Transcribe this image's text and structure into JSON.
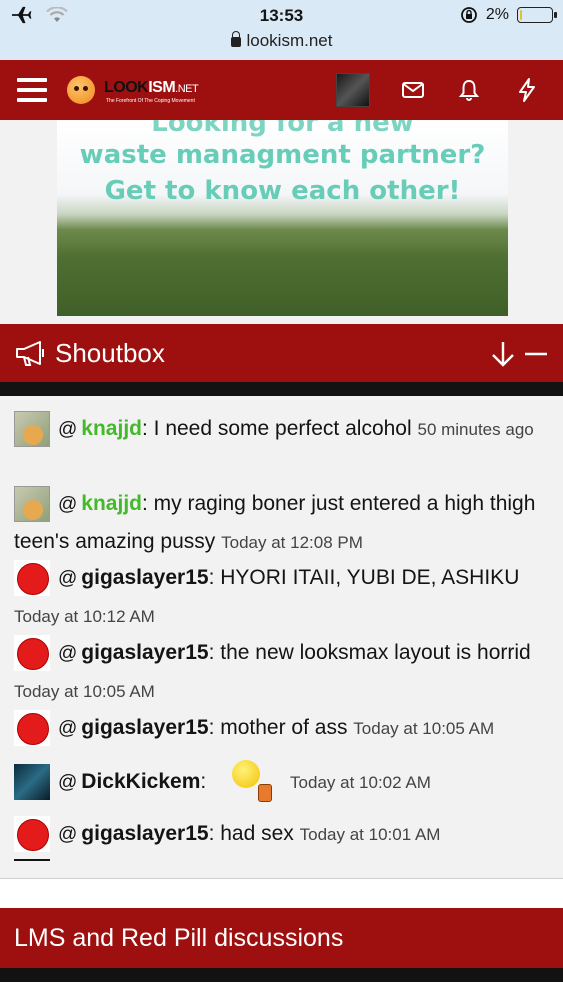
{
  "status_bar": {
    "time": "13:53",
    "battery": "2%",
    "battery_level": 0.02,
    "url": "lookism.net"
  },
  "site": {
    "logo_look": "LOOK",
    "logo_ism": "ISM",
    "logo_net": ".NET",
    "logo_tagline": "The Forefront Of The Coping Movement"
  },
  "banner": {
    "line0": "Looking for a new",
    "line1": "waste managment partner?",
    "line2": "Get to know each other!"
  },
  "shoutbox": {
    "title": "Shoutbox",
    "messages": [
      {
        "user": "knajjd",
        "text": ": I need some perfect alcohol ",
        "time": "50 minutes ago",
        "avatar": "cheems-avatar"
      },
      {
        "user": "knajjd",
        "text": ": my raging boner just entered a high thigh teen's amazing pussy ",
        "time": "Today at 12:08 PM",
        "avatar": "cheems-avatar"
      },
      {
        "user": "gigaslayer15",
        "text": ": HYORI ITAII, YUBI DE, ASHIKU ",
        "time": "Today at 10:12 AM",
        "avatar": "red-face-avatar"
      },
      {
        "user": "gigaslayer15",
        "text": ": the new looksmax layout is horrid ",
        "time": "Today at 10:05 AM",
        "avatar": "red-face-avatar"
      },
      {
        "user": "gigaslayer15",
        "text": ": mother of ass ",
        "time": "Today at 10:05 AM",
        "avatar": "red-face-avatar"
      },
      {
        "user": "DickKickem",
        "text": ": ",
        "time": "Today at 10:02 AM",
        "avatar": "dark-mask-avatar"
      },
      {
        "user": "gigaslayer15",
        "text": ": had sex ",
        "time": "Today at 10:01 AM",
        "avatar": "red-face-avatar"
      }
    ]
  },
  "section": {
    "title": "LMS and Red Pill discussions"
  },
  "colors": {
    "header_red": "#9e1010",
    "username_green": "#44b92a",
    "banner_text": "#67cdb8"
  }
}
